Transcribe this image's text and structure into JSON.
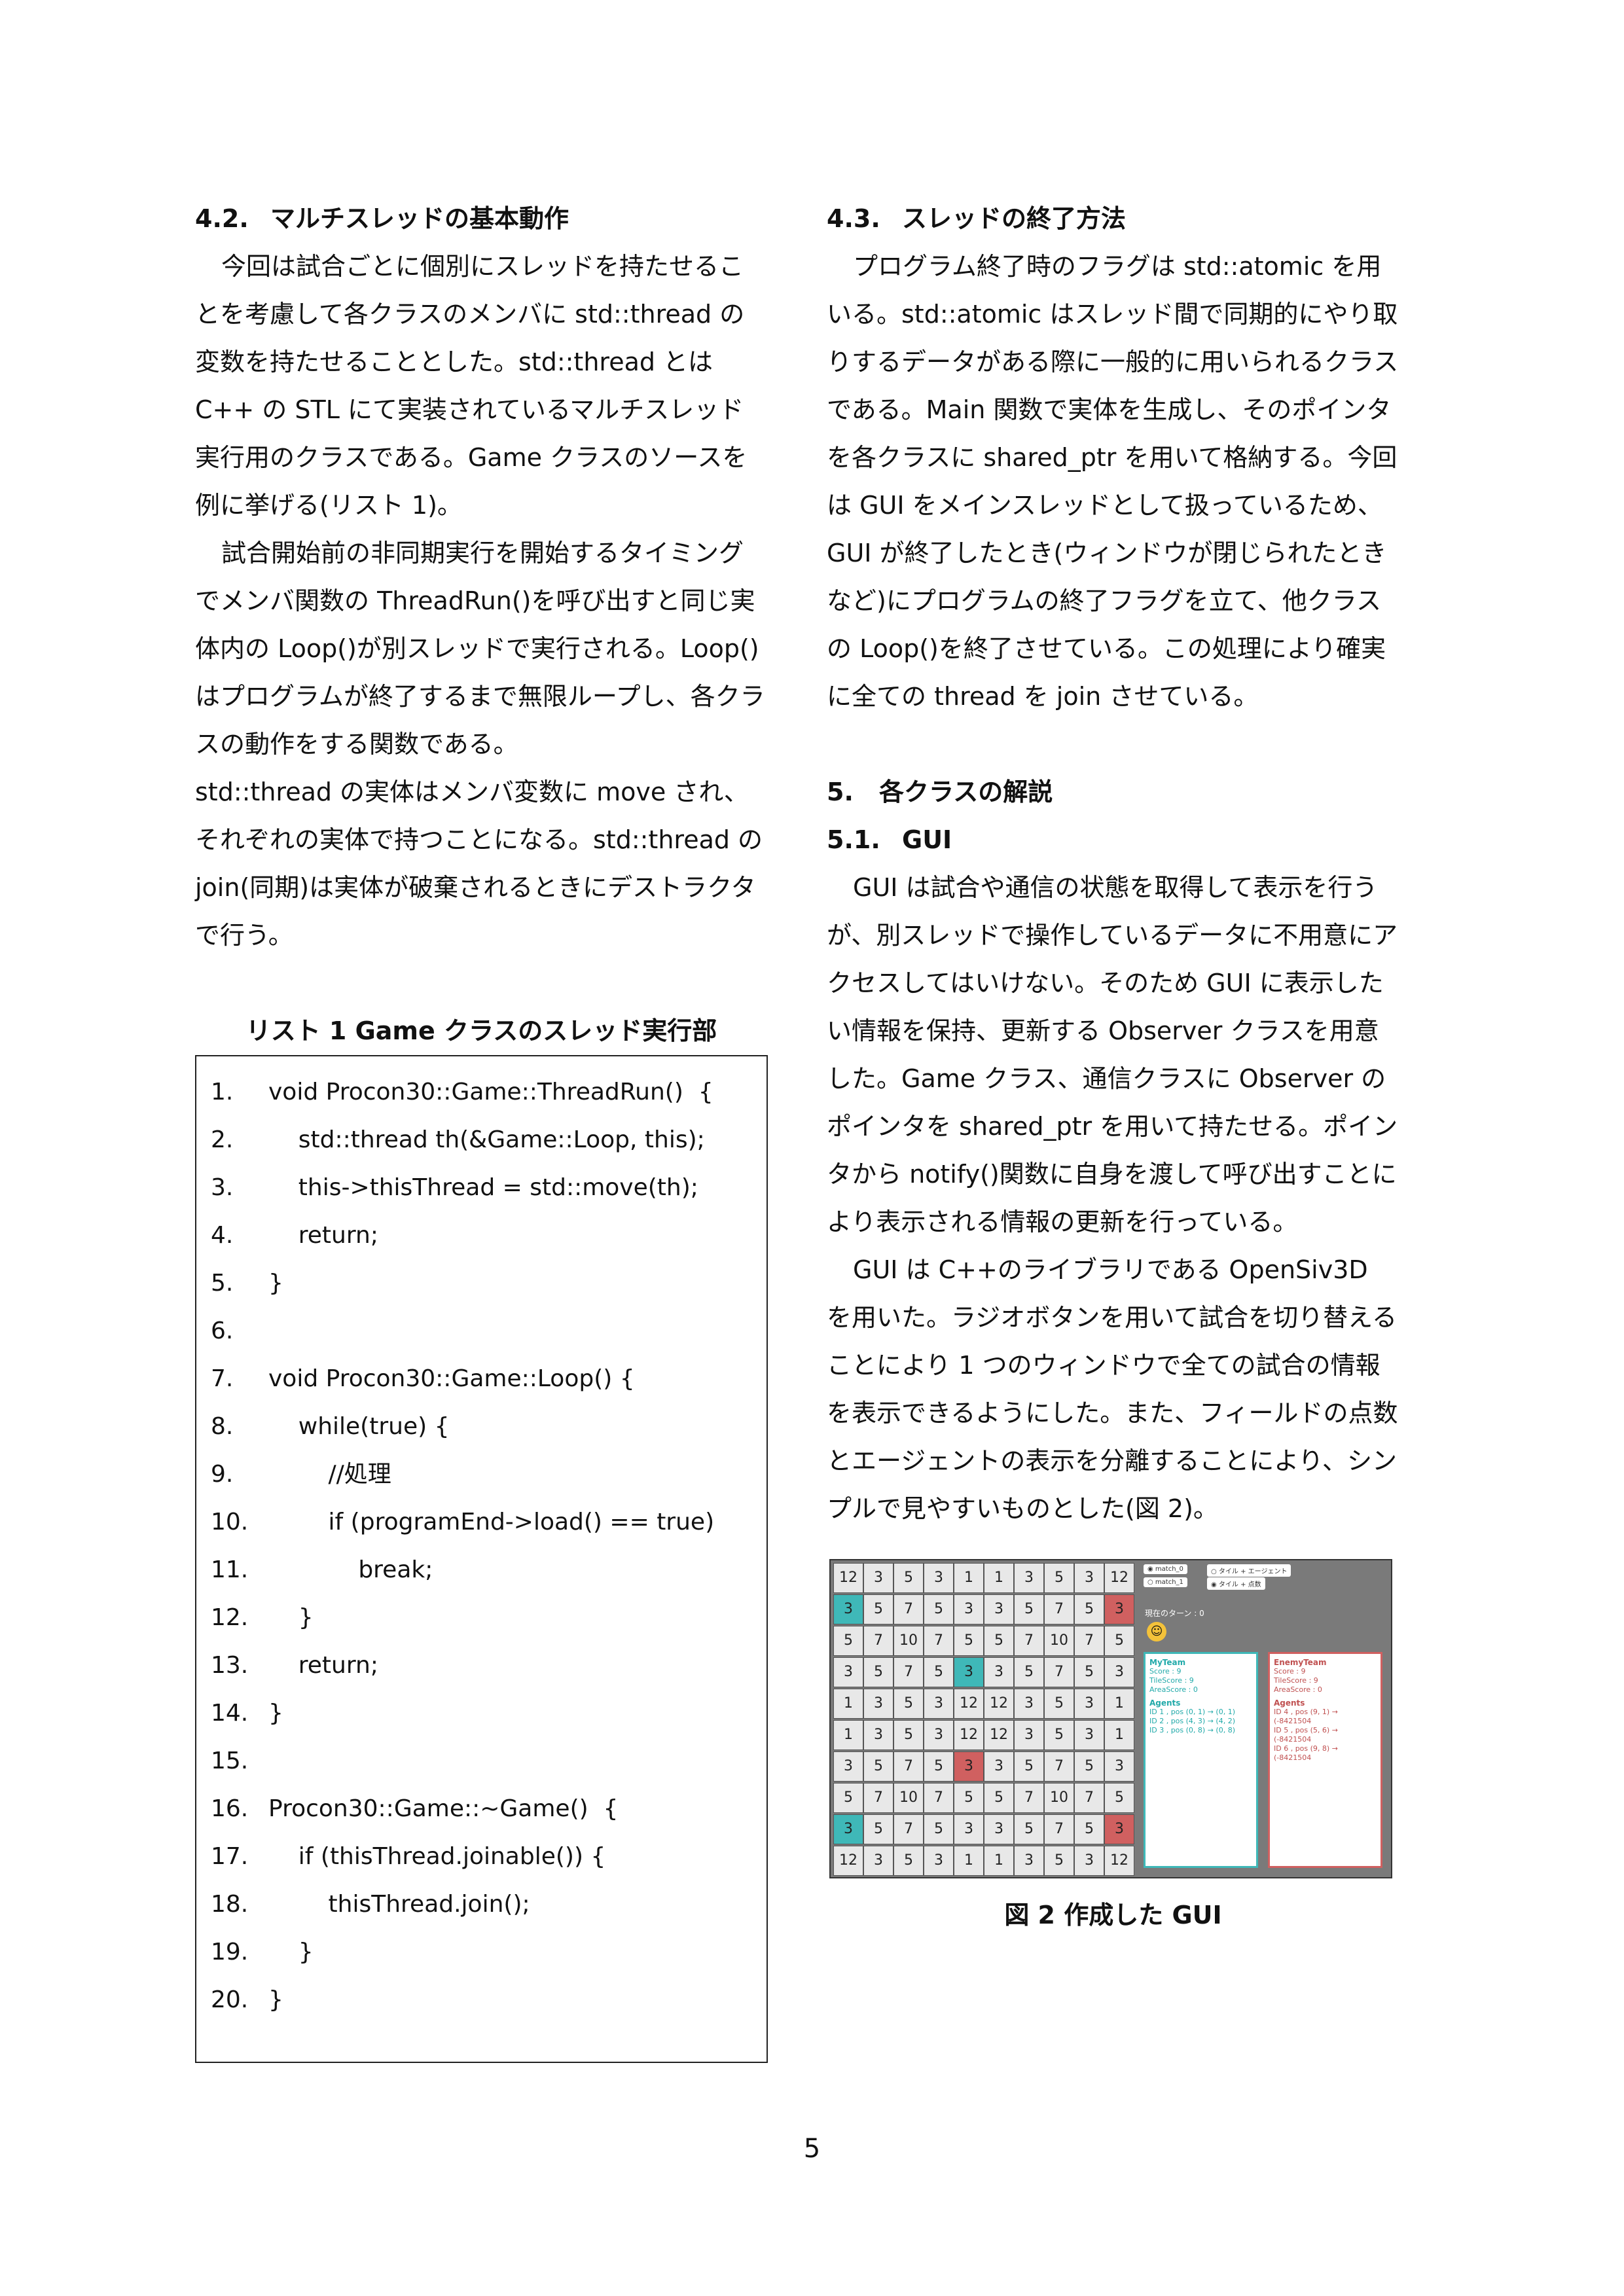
{
  "left": {
    "h42_num": "4.2.",
    "h42_title": "マルチスレッドの基本動作",
    "p1": "今回は試合ごとに個別にスレッドを持たせることを考慮して各クラスのメンバに std::thread の変数を持たせることとした。std::thread とは C++ の STL にて実装されているマルチスレッド実行用のクラスである。Game クラスのソースを例に挙げる(リスト 1)。",
    "p2": "試合開始前の非同期実行を開始するタイミングでメンバ関数の ThreadRun()を呼び出すと同じ実体内の Loop()が別スレッドで実行される。Loop()はプログラムが終了するまで無限ループし、各クラスの動作をする関数である。",
    "p3": "std::thread の実体はメンバ変数に move され、それぞれの実体で持つことになる。std::thread の join(同期)は実体が破棄されるときにデストラクタで行う。",
    "listing_caption": "リスト 1 Game クラスのスレッド実行部",
    "code": [
      {
        "n": "1.",
        "c": "void Procon30::Game::ThreadRun()  {"
      },
      {
        "n": "2.",
        "c": "    std::thread th(&Game::Loop, this);"
      },
      {
        "n": "3.",
        "c": "    this->thisThread = std::move(th);"
      },
      {
        "n": "4.",
        "c": "    return;"
      },
      {
        "n": "5.",
        "c": "}"
      },
      {
        "n": "6.",
        "c": ""
      },
      {
        "n": "7.",
        "c": "void Procon30::Game::Loop() {"
      },
      {
        "n": "8.",
        "c": "    while(true) {"
      },
      {
        "n": "9.",
        "c": "        //処理"
      },
      {
        "n": "10.",
        "c": "        if (programEnd->load() == true)"
      },
      {
        "n": "11.",
        "c": "            break;"
      },
      {
        "n": "12.",
        "c": "    }"
      },
      {
        "n": "13.",
        "c": "    return;"
      },
      {
        "n": "14.",
        "c": "}"
      },
      {
        "n": "15.",
        "c": ""
      },
      {
        "n": "16.",
        "c": "Procon30::Game::~Game()  {"
      },
      {
        "n": "17.",
        "c": "    if (thisThread.joinable()) {"
      },
      {
        "n": "18.",
        "c": "        thisThread.join();"
      },
      {
        "n": "19.",
        "c": "    }"
      },
      {
        "n": "20.",
        "c": "}"
      }
    ]
  },
  "right": {
    "h43_num": "4.3.",
    "h43_title": "スレッドの終了方法",
    "p1": "プログラム終了時のフラグは std::atomic を用いる。std::atomic はスレッド間で同期的にやり取りするデータがある際に一般的に用いられるクラスである。Main 関数で実体を生成し、そのポインタを各クラスに shared_ptr を用いて格納する。今回は GUI をメインスレッドとして扱っているため、GUI が終了したとき(ウィンドウが閉じられたときなど)にプログラムの終了フラグを立て、他クラスの Loop()を終了させている。この処理により確実に全ての thread を join させている。",
    "h5_num": "5.",
    "h5_title": "各クラスの解説",
    "h51_num": "5.1.",
    "h51_title": "GUI",
    "p2": "GUI は試合や通信の状態を取得して表示を行うが、別スレッドで操作しているデータに不用意にアクセスしてはいけない。そのため GUI に表示したい情報を保持、更新する Observer クラスを用意した。Game クラス、通信クラスに Observer のポインタを shared_ptr を用いて持たせる。ポインタから notify()関数に自身を渡して呼び出すことにより表示される情報の更新を行っている。",
    "p3": "GUI は C++のライブラリである OpenSiv3D を用いた。ラジオボタンを用いて試合を切り替えることにより 1 つのウィンドウで全ての試合の情報を表示できるようにした。また、フィールドの点数とエージェントの表示を分離することにより、シンプルで見やすいものとした(図 2)。",
    "figure_caption": "図 2  作成した GUI",
    "gui": {
      "radio1": "match_0",
      "radio2": "match_1",
      "radio3": "タイル + エージェント",
      "radio4": "タイル + 点数",
      "turn": "現在のターン : 0",
      "myteam": {
        "title": "MyTeam",
        "score": "Score : 9",
        "tile": "TileScore : 9",
        "area": "AreaScore : 0",
        "agents": "Agents",
        "a1": "ID 1 , pos (0, 1) → (0, 1)",
        "a2": "ID 2 , pos (4, 3) → (4, 2)",
        "a3": "ID 3 , pos (0, 8) → (0, 8)"
      },
      "enemy": {
        "title": "EnemyTeam",
        "score": "Score : 9",
        "tile": "TileScore : 9",
        "area": "AreaScore : 0",
        "agents": "Agents",
        "a1": "ID 4 , pos (9, 1) → (-8421504",
        "a2": "ID 5 , pos (5, 6) → (-8421504",
        "a3": "ID 6 , pos (9, 8) → (-8421504"
      },
      "grid": [
        [
          "12",
          "3",
          "5",
          "3",
          "1",
          "1",
          "3",
          "5",
          "3",
          "12"
        ],
        [
          "3",
          "5",
          "7",
          "5",
          "3",
          "3",
          "5",
          "7",
          "5",
          "3"
        ],
        [
          "5",
          "7",
          "10",
          "7",
          "5",
          "5",
          "7",
          "10",
          "7",
          "5"
        ],
        [
          "3",
          "5",
          "7",
          "5",
          "3",
          "3",
          "5",
          "7",
          "5",
          "3"
        ],
        [
          "1",
          "3",
          "5",
          "3",
          "12",
          "12",
          "3",
          "5",
          "3",
          "1"
        ],
        [
          "1",
          "3",
          "5",
          "3",
          "12",
          "12",
          "3",
          "5",
          "3",
          "1"
        ],
        [
          "3",
          "5",
          "7",
          "5",
          "3",
          "3",
          "5",
          "7",
          "5",
          "3"
        ],
        [
          "5",
          "7",
          "10",
          "7",
          "5",
          "5",
          "7",
          "10",
          "7",
          "5"
        ],
        [
          "3",
          "5",
          "7",
          "5",
          "3",
          "3",
          "5",
          "7",
          "5",
          "3"
        ],
        [
          "12",
          "3",
          "5",
          "3",
          "1",
          "1",
          "3",
          "5",
          "3",
          "12"
        ]
      ],
      "cyan_cells": [
        [
          1,
          0
        ],
        [
          3,
          4
        ],
        [
          8,
          0
        ]
      ],
      "red_cells": [
        [
          1,
          9
        ],
        [
          6,
          4
        ],
        [
          8,
          9
        ]
      ],
      "team_colors": {
        "mine": "#3fb8b8",
        "enemy": "#d06060"
      }
    }
  },
  "page_number": "5"
}
